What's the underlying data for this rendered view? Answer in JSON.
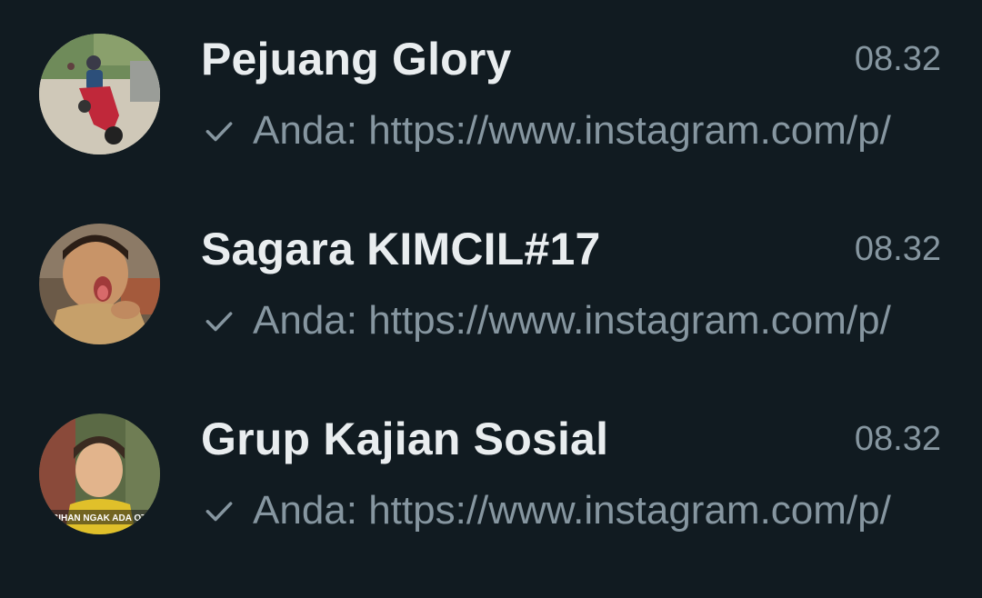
{
  "chats": [
    {
      "name": "Pejuang Glory",
      "time": "08.32",
      "preview": "Anda: https://www.instagram.com/p/",
      "status_icon": "single-check-icon",
      "avatar_icon": "group-photo-motorbike"
    },
    {
      "name": "Sagara KIMCIL#17",
      "time": "08.32",
      "preview": "Anda: https://www.instagram.com/p/",
      "status_icon": "single-check-icon",
      "avatar_icon": "group-photo-child"
    },
    {
      "name": "Grup Kajian Sosial",
      "time": "08.32",
      "preview": "Anda: https://www.instagram.com/p/",
      "status_icon": "single-check-icon",
      "avatar_icon": "group-photo-boy-meme",
      "avatar_caption": "ASIHAN NGAK ADA OTA"
    }
  ],
  "colors": {
    "background": "#111b21",
    "title": "#e9edef",
    "secondary": "#8696a0"
  }
}
